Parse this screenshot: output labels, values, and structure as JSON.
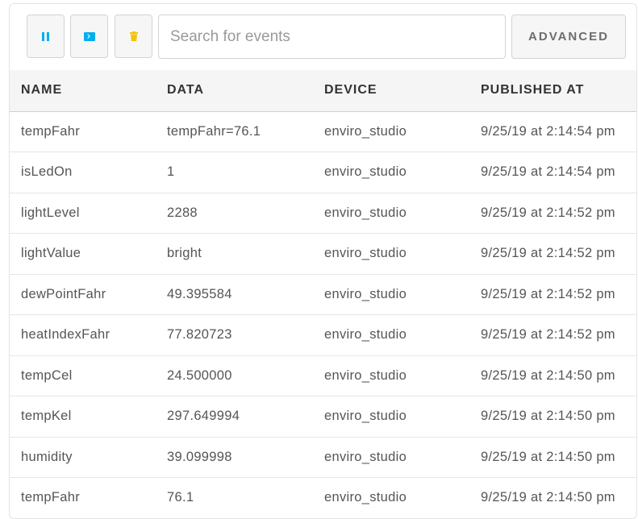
{
  "toolbar": {
    "pause_icon": "pause-icon",
    "console_icon": "terminal-icon",
    "clear_icon": "trash-icon",
    "search_placeholder": "Search for events",
    "search_value": "",
    "advanced_label": "ADVANCED",
    "accent_color": "#00aeef",
    "trash_color": "#f5c400"
  },
  "table": {
    "columns": [
      "NAME",
      "DATA",
      "DEVICE",
      "PUBLISHED AT"
    ],
    "rows": [
      {
        "name": "tempFahr",
        "data": "tempFahr=76.1",
        "device": "enviro_studio",
        "published": "9/25/19 at 2:14:54 pm"
      },
      {
        "name": "isLedOn",
        "data": "1",
        "device": "enviro_studio",
        "published": "9/25/19 at 2:14:54 pm"
      },
      {
        "name": "lightLevel",
        "data": "2288",
        "device": "enviro_studio",
        "published": "9/25/19 at 2:14:52 pm"
      },
      {
        "name": "lightValue",
        "data": "bright",
        "device": "enviro_studio",
        "published": "9/25/19 at 2:14:52 pm"
      },
      {
        "name": "dewPointFahr",
        "data": "49.395584",
        "device": "enviro_studio",
        "published": "9/25/19 at 2:14:52 pm"
      },
      {
        "name": "heatIndexFahr",
        "data": "77.820723",
        "device": "enviro_studio",
        "published": "9/25/19 at 2:14:52 pm"
      },
      {
        "name": "tempCel",
        "data": "24.500000",
        "device": "enviro_studio",
        "published": "9/25/19 at 2:14:50 pm"
      },
      {
        "name": "tempKel",
        "data": "297.649994",
        "device": "enviro_studio",
        "published": "9/25/19 at 2:14:50 pm"
      },
      {
        "name": "humidity",
        "data": "39.099998",
        "device": "enviro_studio",
        "published": "9/25/19 at 2:14:50 pm"
      },
      {
        "name": "tempFahr",
        "data": "76.1",
        "device": "enviro_studio",
        "published": "9/25/19 at 2:14:50 pm"
      }
    ]
  }
}
